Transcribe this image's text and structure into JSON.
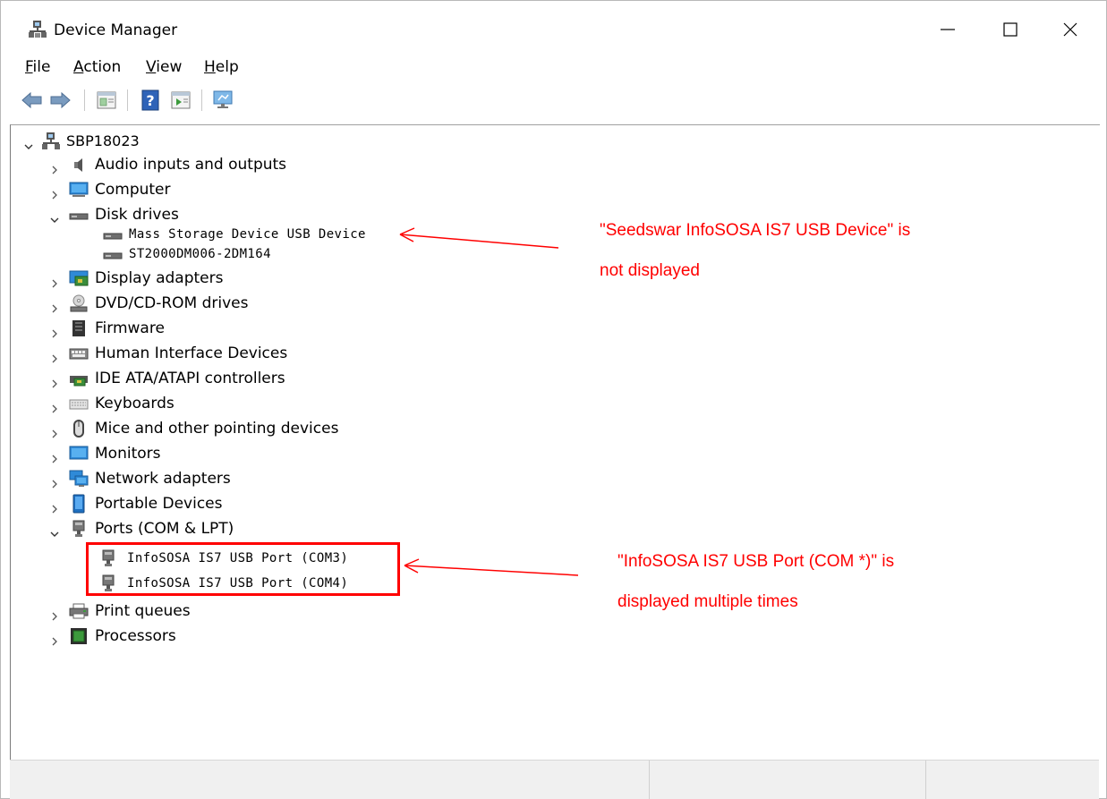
{
  "window": {
    "title": "Device Manager",
    "controls": {
      "minimize": "minimize",
      "maximize": "maximize",
      "close": "close"
    }
  },
  "menu": [
    {
      "mnemonic": "F",
      "rest": "ile"
    },
    {
      "mnemonic": "A",
      "rest": "ction"
    },
    {
      "mnemonic": "V",
      "rest": "iew"
    },
    {
      "mnemonic": "H",
      "rest": "elp"
    }
  ],
  "toolbar": [
    "back-icon",
    "forward-icon",
    "properties-icon",
    "help-icon",
    "run-icon",
    "monitor-icon"
  ],
  "tree": {
    "root": "SBP18023",
    "categories": [
      {
        "label": "Audio inputs and outputs",
        "icon": "speaker-icon",
        "expanded": false
      },
      {
        "label": "Computer",
        "icon": "computer-icon",
        "expanded": false
      },
      {
        "label": "Disk drives",
        "icon": "disk-drive-icon",
        "expanded": true,
        "children": [
          "Mass Storage Device USB Device",
          "ST2000DM006-2DM164"
        ]
      },
      {
        "label": "Display adapters",
        "icon": "display-adapter-icon",
        "expanded": false
      },
      {
        "label": "DVD/CD-ROM drives",
        "icon": "dvd-icon",
        "expanded": false
      },
      {
        "label": "Firmware",
        "icon": "firmware-icon",
        "expanded": false
      },
      {
        "label": "Human Interface Devices",
        "icon": "hid-icon",
        "expanded": false
      },
      {
        "label": "IDE ATA/ATAPI controllers",
        "icon": "ide-controller-icon",
        "expanded": false
      },
      {
        "label": "Keyboards",
        "icon": "keyboard-icon",
        "expanded": false
      },
      {
        "label": "Mice and other pointing devices",
        "icon": "mouse-icon",
        "expanded": false
      },
      {
        "label": "Monitors",
        "icon": "monitor-icon",
        "expanded": false
      },
      {
        "label": "Network adapters",
        "icon": "network-adapter-icon",
        "expanded": false
      },
      {
        "label": "Portable Devices",
        "icon": "portable-device-icon",
        "expanded": false
      },
      {
        "label": "Ports (COM & LPT)",
        "icon": "port-icon",
        "expanded": true,
        "children": [
          "InfoSOSA IS7 USB Port (COM3)",
          "InfoSOSA IS7 USB Port (COM4)"
        ]
      },
      {
        "label": "Print queues",
        "icon": "printer-icon",
        "expanded": false
      },
      {
        "label": "Processors",
        "icon": "processor-icon",
        "expanded": false
      }
    ]
  },
  "annotations": {
    "disk_note_line1": "\"Seedswar InfoSOSA IS7 USB Device\" is",
    "disk_note_line2": "not displayed",
    "port_note_line1": "\"InfoSOSA IS7 USB Port (COM *)\" is",
    "port_note_line2": "displayed multiple times",
    "color": "#ff0000"
  }
}
